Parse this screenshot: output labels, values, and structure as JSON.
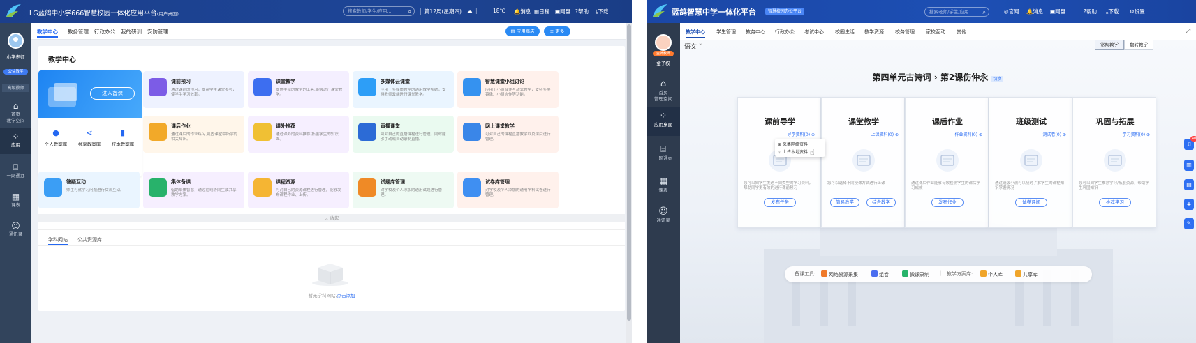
{
  "left": {
    "header": {
      "title": "LG蓝鸽中小学666智慧校园一体化应用平台",
      "subtitle": "(用户桌面)",
      "search_placeholder": "搜索教师/学生/应用...",
      "week": "第12周(星期四)",
      "weather": "18℃",
      "links": [
        "消息",
        "日程",
        "网盘",
        "帮助",
        "下载"
      ]
    },
    "sidebar": {
      "user_name": "小学老师",
      "badge": "公益教学",
      "role": "高级教师",
      "items": [
        {
          "label": "首页",
          "sub": "教学空间",
          "icon": "home-icon"
        },
        {
          "label": "应用",
          "icon": "apps-icon"
        },
        {
          "label": "一网通办",
          "icon": "building-icon"
        },
        {
          "label": "课表",
          "icon": "calendar-icon"
        },
        {
          "label": "通讯录",
          "icon": "contacts-icon"
        }
      ]
    },
    "tabs": [
      "教学中心",
      "教务管理",
      "行政办公",
      "我的研训",
      "安防管理"
    ],
    "buttons": {
      "app_store": "应用商店",
      "more": "更多"
    },
    "center": {
      "title": "教学中心",
      "enter": "进入备课",
      "libraries": [
        "个人教案库",
        "共享教案库",
        "校本教案库"
      ],
      "tiles": [
        {
          "title": "课前预习",
          "desc": "通过课前的预习，提高学生课堂参与，使学生学习效率。",
          "color": "#7c5ce6",
          "bg": "#eef2ff"
        },
        {
          "title": "课堂教学",
          "desc": "提供丰富的教室的工具,能够进行课堂教学。",
          "color": "#3d6ef0",
          "bg": "#f4efff"
        },
        {
          "title": "多媒体云课堂",
          "desc": "应用于多媒体教室的通用教学系统，支持教师云端进行课堂教学。",
          "color": "#2d9ef7",
          "bg": "#eaf5ff"
        },
        {
          "title": "智慧课堂小组讨论",
          "desc": "应用于小组合作互动式教学，支持多屏镜像、小组协作等功能。",
          "color": "#3592f0",
          "bg": "#fff1ec"
        },
        {
          "title": "课后作业",
          "desc": "通过课后的作业练习,巩固课堂中所学的相关知识。",
          "color": "#f2a929",
          "bg": "#fff6ea"
        },
        {
          "title": "课外推荐",
          "desc": "通过课外的资料推荐,拓展学生的知识面。",
          "color": "#f0c034",
          "bg": "#f6efff"
        },
        {
          "title": "直播课堂",
          "desc": "可对自己的直播课程进行管理，同时能够手动或自动录制直播。",
          "color": "#2c6bd6",
          "bg": "#eafaf0"
        },
        {
          "title": "网上课堂教学",
          "desc": "可对自己的课程直播教学以及课后进行管理。",
          "color": "#3a86e8",
          "bg": "#fff1ec"
        },
        {
          "title": "答疑互动",
          "desc": "师生可就学习问题进行交流互动。",
          "color": "#3b9ef5",
          "bg": "#eaf5ff"
        },
        {
          "title": "集体备课",
          "desc": "借助集体智慧，通过在线协同生成共享教学方案。",
          "color": "#28b26b",
          "bg": "#f6efff"
        },
        {
          "title": "课程资源",
          "desc": "可对自己的资源课程进行管理，能够发布课程作业、上传。",
          "color": "#f5b533",
          "bg": "#f6efff"
        },
        {
          "title": "试题库管理",
          "desc": "对学校及个人添加的通用试题进行管理。",
          "color": "#ef8a26",
          "bg": "#eefaf3"
        },
        {
          "title": "试卷库管理",
          "desc": "对学校及个人添加的通用学科试卷进行管理。",
          "color": "#3f8ff2",
          "bg": "#fff1ec"
        }
      ],
      "collapse": "收起",
      "section_tabs": [
        "学科网站",
        "公共资源库"
      ],
      "empty_text": "暂无学科网站,",
      "empty_link": "点击添加"
    }
  },
  "right": {
    "header": {
      "title": "蓝鸽智慧中学一体化平台",
      "tag": "智慧校园办公平台",
      "search_placeholder": "搜索老师/学生/应用...",
      "links": [
        "官网",
        "消息",
        "网盘",
        "帮助",
        "下载",
        "设置"
      ]
    },
    "sidebar": {
      "badge": "金牌教师",
      "user_name": "金子权",
      "items": [
        {
          "label": "首页",
          "sub": "管理空间",
          "icon": "home-icon"
        },
        {
          "label": "应用桌面",
          "icon": "apps-icon"
        },
        {
          "label": "一网通办",
          "icon": "building-icon"
        },
        {
          "label": "课表",
          "icon": "calendar-icon"
        },
        {
          "label": "通讯录",
          "icon": "contacts-icon"
        }
      ]
    },
    "tabs": [
      "教学中心",
      "学生管理",
      "教务中心",
      "行政办公",
      "考试中心",
      "校园生活",
      "教学资源",
      "校务管理",
      "家校互动",
      "其他"
    ],
    "subject": "语文",
    "view_toggle": [
      "常规教学",
      "翻转教学"
    ],
    "lesson": {
      "unit": "第四单元古诗词",
      "lesson": "第2课伤仲永",
      "switch": "切换"
    },
    "panels": [
      {
        "title": "课前导学",
        "link": "导学资料(0)",
        "desc": "您可以向学生发送不同类型的学习资料，帮助同学更有效的进行课前预习",
        "buttons": [
          "发布任务"
        ]
      },
      {
        "title": "课堂教学",
        "link": "上课资料(0)",
        "desc": "您可以选择不同授课方式进行上课",
        "buttons": [
          "简易教学",
          "综合教学"
        ]
      },
      {
        "title": "课后作业",
        "link": "作业资料(0)",
        "desc": "通过课后作业能够有效检测学生的课后学习成效",
        "buttons": [
          "发布作业"
        ]
      },
      {
        "title": "班级测试",
        "link": "测试卷(0)",
        "desc": "通过班级小测可以及时了解学生的课程知识掌握情况",
        "buttons": [
          "试卷评阅"
        ]
      },
      {
        "title": "巩固与拓展",
        "link": "学习资料(0)",
        "desc": "您可以向学生推荐学习/拓展资源，帮助学生巩固知识",
        "buttons": [
          "推荐学习"
        ]
      }
    ],
    "popup": [
      "采集网络资料",
      "上传本地资料"
    ],
    "tools": {
      "label": "备课工具:",
      "items": [
        {
          "label": "网络资源采集",
          "color": "#f07a2b"
        },
        {
          "label": "组卷",
          "color": "#4b6ef0"
        },
        {
          "label": "微课录制",
          "color": "#27b36a"
        }
      ],
      "lib_label": "教学方案库:",
      "libs": [
        {
          "label": "个人库",
          "color": "#f0a52a"
        },
        {
          "label": "共享库",
          "color": "#f0a52a"
        }
      ]
    },
    "right_badge": "40"
  }
}
